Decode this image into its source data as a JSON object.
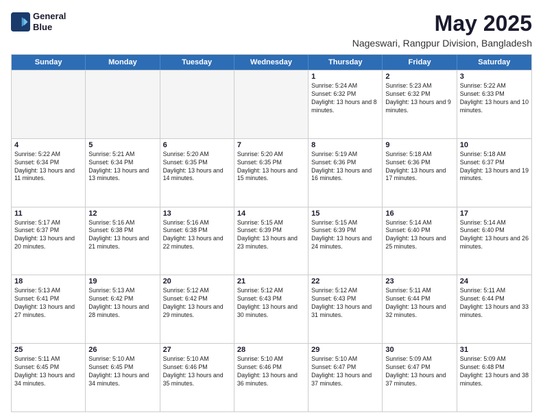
{
  "logo": {
    "line1": "General",
    "line2": "Blue"
  },
  "title": "May 2025",
  "subtitle": "Nageswari, Rangpur Division, Bangladesh",
  "days": [
    "Sunday",
    "Monday",
    "Tuesday",
    "Wednesday",
    "Thursday",
    "Friday",
    "Saturday"
  ],
  "weeks": [
    [
      {
        "day": "",
        "empty": true
      },
      {
        "day": "",
        "empty": true
      },
      {
        "day": "",
        "empty": true
      },
      {
        "day": "",
        "empty": true
      },
      {
        "day": "1",
        "sunrise": "5:24 AM",
        "sunset": "6:32 PM",
        "daylight": "13 hours and 8 minutes."
      },
      {
        "day": "2",
        "sunrise": "5:23 AM",
        "sunset": "6:32 PM",
        "daylight": "13 hours and 9 minutes."
      },
      {
        "day": "3",
        "sunrise": "5:22 AM",
        "sunset": "6:33 PM",
        "daylight": "13 hours and 10 minutes."
      }
    ],
    [
      {
        "day": "4",
        "sunrise": "5:22 AM",
        "sunset": "6:34 PM",
        "daylight": "13 hours and 11 minutes."
      },
      {
        "day": "5",
        "sunrise": "5:21 AM",
        "sunset": "6:34 PM",
        "daylight": "13 hours and 13 minutes."
      },
      {
        "day": "6",
        "sunrise": "5:20 AM",
        "sunset": "6:35 PM",
        "daylight": "13 hours and 14 minutes."
      },
      {
        "day": "7",
        "sunrise": "5:20 AM",
        "sunset": "6:35 PM",
        "daylight": "13 hours and 15 minutes."
      },
      {
        "day": "8",
        "sunrise": "5:19 AM",
        "sunset": "6:36 PM",
        "daylight": "13 hours and 16 minutes."
      },
      {
        "day": "9",
        "sunrise": "5:18 AM",
        "sunset": "6:36 PM",
        "daylight": "13 hours and 17 minutes."
      },
      {
        "day": "10",
        "sunrise": "5:18 AM",
        "sunset": "6:37 PM",
        "daylight": "13 hours and 19 minutes."
      }
    ],
    [
      {
        "day": "11",
        "sunrise": "5:17 AM",
        "sunset": "6:37 PM",
        "daylight": "13 hours and 20 minutes."
      },
      {
        "day": "12",
        "sunrise": "5:16 AM",
        "sunset": "6:38 PM",
        "daylight": "13 hours and 21 minutes."
      },
      {
        "day": "13",
        "sunrise": "5:16 AM",
        "sunset": "6:38 PM",
        "daylight": "13 hours and 22 minutes."
      },
      {
        "day": "14",
        "sunrise": "5:15 AM",
        "sunset": "6:39 PM",
        "daylight": "13 hours and 23 minutes."
      },
      {
        "day": "15",
        "sunrise": "5:15 AM",
        "sunset": "6:39 PM",
        "daylight": "13 hours and 24 minutes."
      },
      {
        "day": "16",
        "sunrise": "5:14 AM",
        "sunset": "6:40 PM",
        "daylight": "13 hours and 25 minutes."
      },
      {
        "day": "17",
        "sunrise": "5:14 AM",
        "sunset": "6:40 PM",
        "daylight": "13 hours and 26 minutes."
      }
    ],
    [
      {
        "day": "18",
        "sunrise": "5:13 AM",
        "sunset": "6:41 PM",
        "daylight": "13 hours and 27 minutes."
      },
      {
        "day": "19",
        "sunrise": "5:13 AM",
        "sunset": "6:42 PM",
        "daylight": "13 hours and 28 minutes."
      },
      {
        "day": "20",
        "sunrise": "5:12 AM",
        "sunset": "6:42 PM",
        "daylight": "13 hours and 29 minutes."
      },
      {
        "day": "21",
        "sunrise": "5:12 AM",
        "sunset": "6:43 PM",
        "daylight": "13 hours and 30 minutes."
      },
      {
        "day": "22",
        "sunrise": "5:12 AM",
        "sunset": "6:43 PM",
        "daylight": "13 hours and 31 minutes."
      },
      {
        "day": "23",
        "sunrise": "5:11 AM",
        "sunset": "6:44 PM",
        "daylight": "13 hours and 32 minutes."
      },
      {
        "day": "24",
        "sunrise": "5:11 AM",
        "sunset": "6:44 PM",
        "daylight": "13 hours and 33 minutes."
      }
    ],
    [
      {
        "day": "25",
        "sunrise": "5:11 AM",
        "sunset": "6:45 PM",
        "daylight": "13 hours and 34 minutes."
      },
      {
        "day": "26",
        "sunrise": "5:10 AM",
        "sunset": "6:45 PM",
        "daylight": "13 hours and 34 minutes."
      },
      {
        "day": "27",
        "sunrise": "5:10 AM",
        "sunset": "6:46 PM",
        "daylight": "13 hours and 35 minutes."
      },
      {
        "day": "28",
        "sunrise": "5:10 AM",
        "sunset": "6:46 PM",
        "daylight": "13 hours and 36 minutes."
      },
      {
        "day": "29",
        "sunrise": "5:10 AM",
        "sunset": "6:47 PM",
        "daylight": "13 hours and 37 minutes."
      },
      {
        "day": "30",
        "sunrise": "5:09 AM",
        "sunset": "6:47 PM",
        "daylight": "13 hours and 37 minutes."
      },
      {
        "day": "31",
        "sunrise": "5:09 AM",
        "sunset": "6:48 PM",
        "daylight": "13 hours and 38 minutes."
      }
    ]
  ]
}
